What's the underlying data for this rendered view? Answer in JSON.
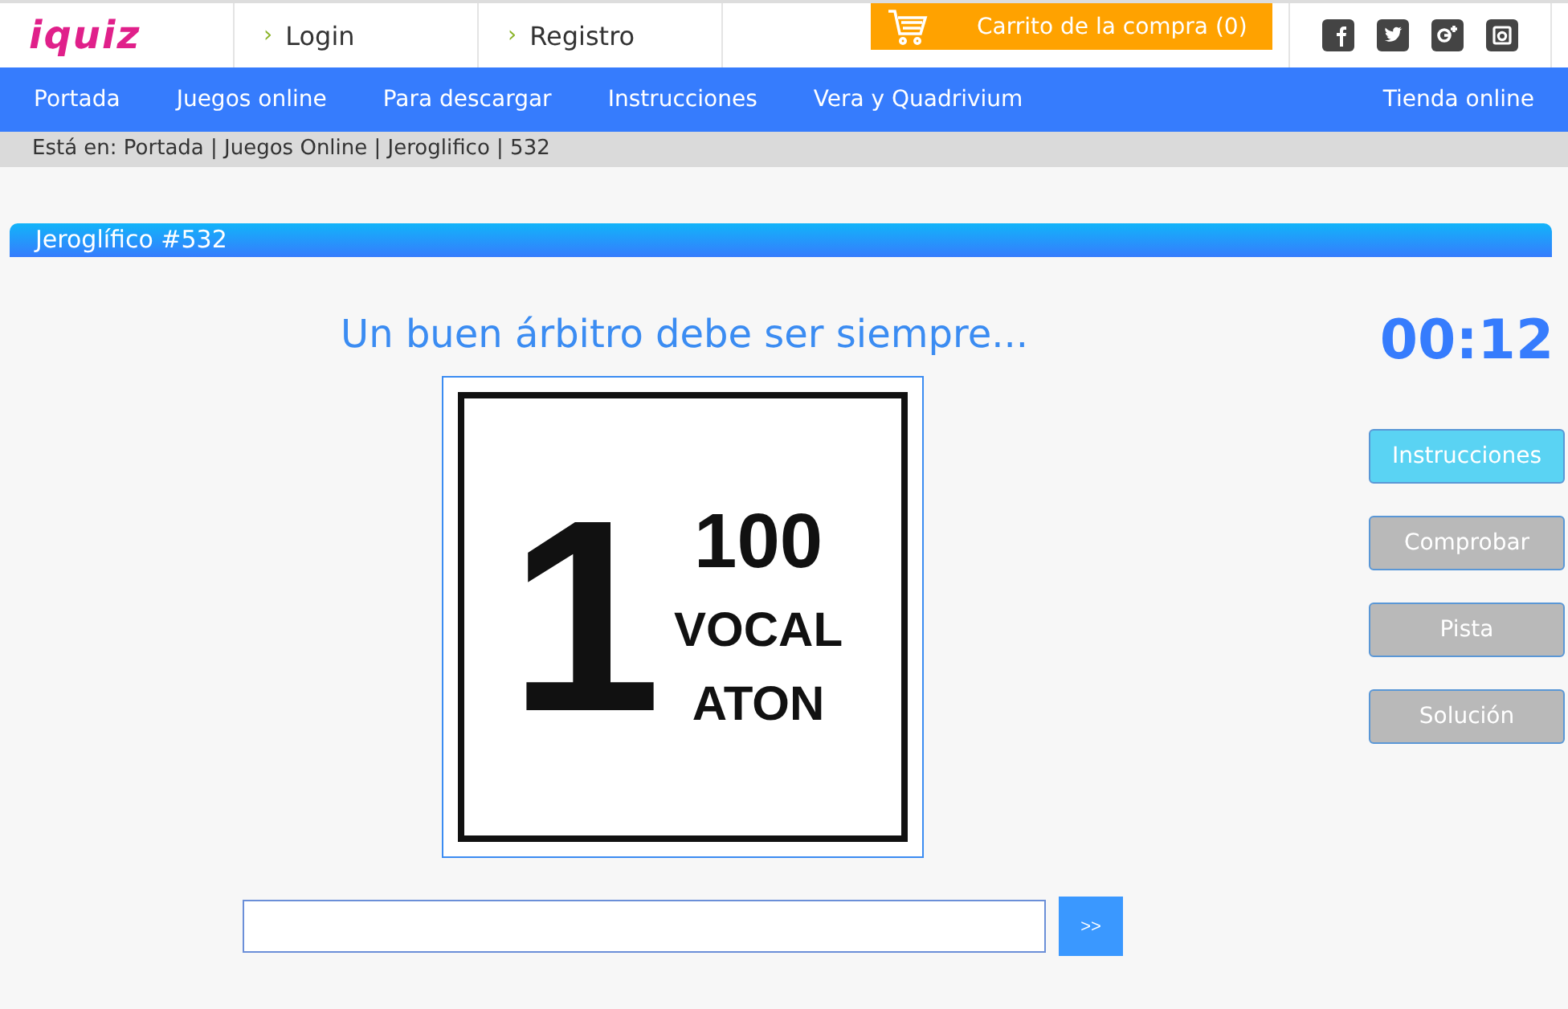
{
  "header": {
    "logo": "iquiz",
    "links": [
      {
        "arrow": "›",
        "label": "Login"
      },
      {
        "arrow": "›",
        "label": "Registro"
      }
    ],
    "cart": "Carrito de la compra (0)",
    "social": [
      {
        "kind": "facebook"
      },
      {
        "kind": "twitter"
      },
      {
        "kind": "google-plus"
      },
      {
        "kind": "instagram"
      }
    ]
  },
  "nav": {
    "items": [
      "Portada",
      "Juegos online",
      "Para descargar",
      "Instrucciones",
      "Vera y Quadrivium"
    ],
    "right": "Tienda online"
  },
  "breadcrumb": "Está en: Portada | Juegos Online | Jeroglifico | 532",
  "panel": {
    "title": "Jeroglífico #532"
  },
  "puzzle": {
    "question": "Un buen árbitro debe ser siempre...",
    "big": "1",
    "lines": [
      "100",
      "VOCAL",
      "ATON"
    ]
  },
  "timer": "00:12",
  "buttons": [
    {
      "label": "Instrucciones",
      "disabled": false
    },
    {
      "label": "Comprobar",
      "disabled": true
    },
    {
      "label": "Pista",
      "disabled": true
    },
    {
      "label": "Solución",
      "disabled": true
    }
  ],
  "answer": {
    "submit": ">>"
  }
}
